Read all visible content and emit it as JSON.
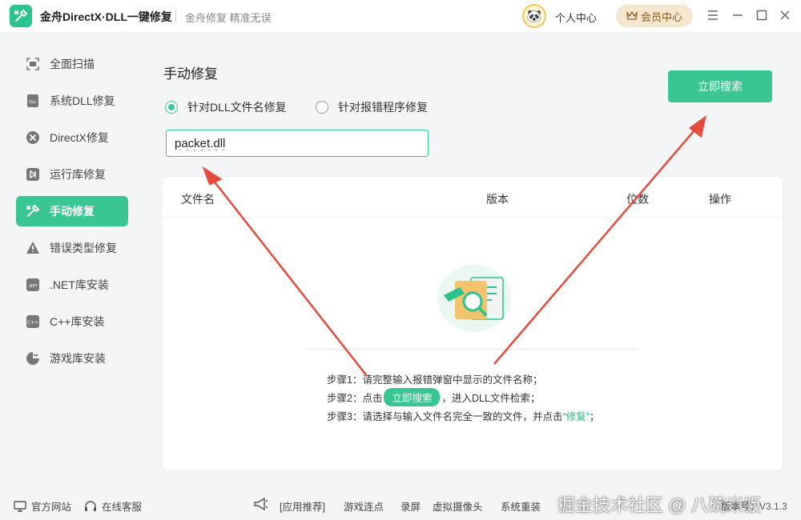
{
  "app": {
    "title": "金舟DirectX·DLL一键修复",
    "slogan": "金舟修复 精准无误",
    "user_center": "个人中心",
    "vip_center": "会员中心",
    "accent": "#3ac693"
  },
  "sidebar": {
    "items": [
      {
        "label": "全面扫描",
        "icon": "scan-icon"
      },
      {
        "label": "系统DLL修复",
        "icon": "dll-icon"
      },
      {
        "label": "DirectX修复",
        "icon": "directx-icon"
      },
      {
        "label": "运行库修复",
        "icon": "runtime-icon"
      },
      {
        "label": "手动修复",
        "icon": "tools-icon",
        "active": true
      },
      {
        "label": "错误类型修复",
        "icon": "warning-icon"
      },
      {
        "label": ".NET库安装",
        "icon": "dotnet-icon"
      },
      {
        "label": "C++库安装",
        "icon": "cpp-icon"
      },
      {
        "label": "游戏库安装",
        "icon": "game-icon"
      }
    ]
  },
  "main": {
    "title": "手动修复",
    "search_button": "立即搜索",
    "radio_options": [
      {
        "label": "针对DLL文件名修复",
        "checked": true
      },
      {
        "label": "针对报错程序修复",
        "checked": false
      }
    ],
    "input_value": "packet.dll",
    "table": {
      "columns": [
        "文件名",
        "版本",
        "位数",
        "操作"
      ]
    },
    "steps": {
      "step1": "步骤1：请完整输入报错弹窗中显示的文件名称；",
      "step2_prefix": "步骤2：点击",
      "step2_button": "立即搜索",
      "step2_suffix": "，进入DLL文件检索；",
      "step3_prefix": "步骤3：请选择与输入文件名完全一致的文件，并点击",
      "step3_highlight": "“修复”",
      "step3_suffix": "；"
    }
  },
  "footer": {
    "official_site": "官方网站",
    "online_service": "在线客服",
    "links": [
      "[应用推荐]",
      "游戏连点",
      "录屏",
      "虚拟摄像头",
      "系统重装"
    ],
    "watermark": "掘金技术社区 @ 八碗米饭",
    "version": "版本号：V3.1.3"
  }
}
